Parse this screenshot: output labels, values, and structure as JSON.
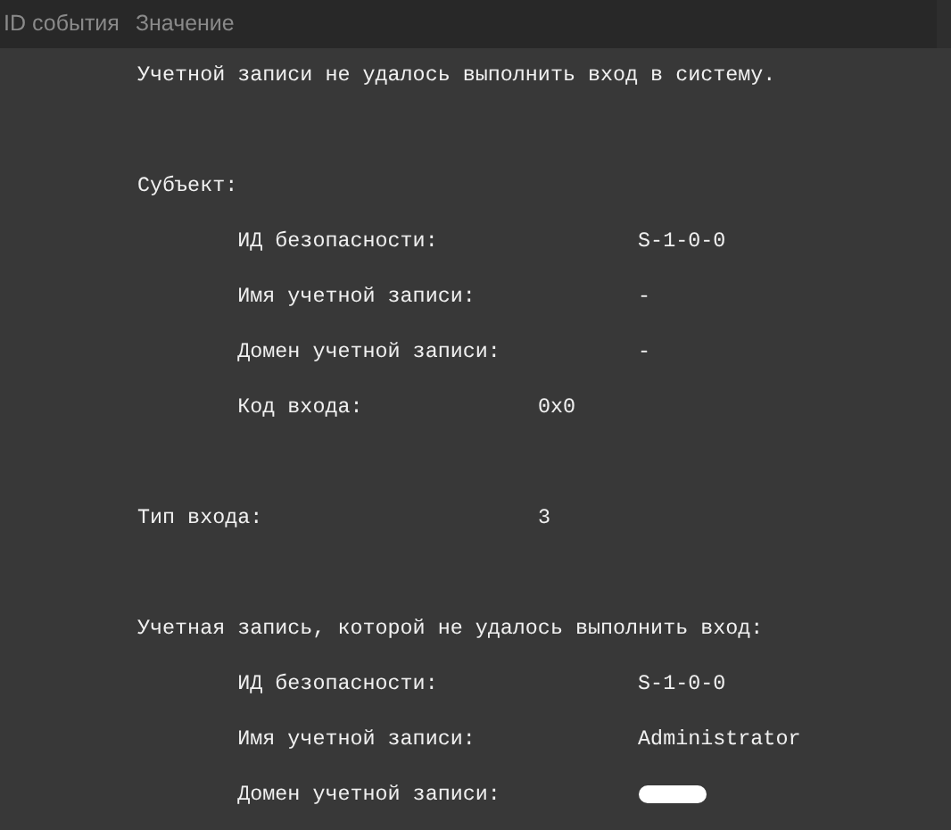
{
  "columns": [
    "ID события",
    "Значение"
  ],
  "message": "Учетной записи не удалось выполнить вход в систему.",
  "groups": [
    {
      "title": "Субъект:",
      "fields": [
        {
          "label": "ИД безопасности:",
          "value": "S-1-0-0"
        },
        {
          "label": "Имя учетной записи:",
          "value": "-"
        },
        {
          "label": "Домен учетной записи:",
          "value": "-"
        },
        {
          "label": "Код входа:",
          "value": "0x0"
        }
      ]
    },
    {
      "label": "Тип входа:",
      "value": "3"
    },
    {
      "title": "Учетная запись, которой не удалось выполнить вход:",
      "fields": [
        {
          "label": "ИД безопасности:",
          "value": "S-1-0-0"
        },
        {
          "label": "Имя учетной записи:",
          "value": "Administrator"
        },
        {
          "label": "Домен учетной записи:",
          "redacted": true
        }
      ]
    }
  ]
}
